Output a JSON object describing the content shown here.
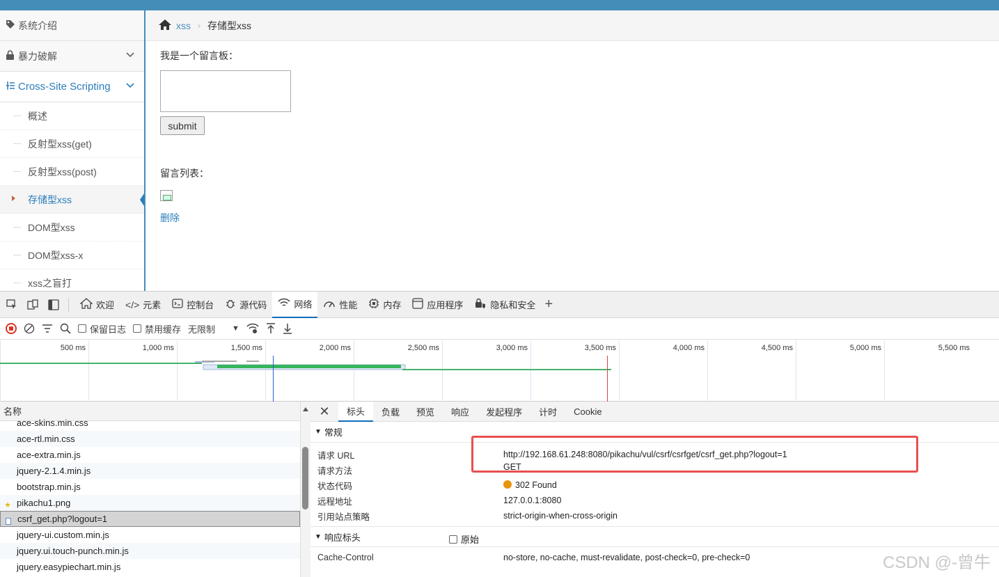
{
  "sidebar": {
    "items": [
      {
        "label": "系统介绍",
        "icon": "tag-icon"
      },
      {
        "label": "暴力破解",
        "icon": "lock-icon"
      },
      {
        "label": "Cross-Site Scripting",
        "icon": "list-icon"
      }
    ],
    "subitems": [
      "概述",
      "反射型xss(get)",
      "反射型xss(post)",
      "存储型xss",
      "DOM型xss",
      "DOM型xss-x",
      "xss之盲打"
    ]
  },
  "breadcrumb": {
    "link": "xss",
    "current": "存储型xss"
  },
  "main": {
    "board_label": "我是一个留言板：",
    "submit_label": "submit",
    "list_title": "留言列表：",
    "delete_label": "删除"
  },
  "devtools": {
    "tabs": [
      {
        "label": "欢迎",
        "icon": "home-icon"
      },
      {
        "label": "元素",
        "icon": "code-icon"
      },
      {
        "label": "控制台",
        "icon": "console-icon"
      },
      {
        "label": "源代码",
        "icon": "bug-icon"
      },
      {
        "label": "网络",
        "icon": "wifi-icon"
      },
      {
        "label": "性能",
        "icon": "gauge-icon"
      },
      {
        "label": "内存",
        "icon": "chip-icon"
      },
      {
        "label": "应用程序",
        "icon": "window-icon"
      },
      {
        "label": "隐私和安全",
        "icon": "shield-lock-icon"
      }
    ],
    "toolbar": {
      "preserve_log": "保留日志",
      "disable_cache": "禁用缓存",
      "throttle": "无限制"
    },
    "timeline_ticks": [
      "500 ms",
      "1,000 ms",
      "1,500 ms",
      "2,000 ms",
      "2,500 ms",
      "3,000 ms",
      "3,500 ms",
      "4,000 ms",
      "4,500 ms",
      "5,000 ms",
      "5,500 ms"
    ],
    "list_header": "名称",
    "requests": [
      "ace-skins.min.css",
      "ace-rtl.min.css",
      "ace-extra.min.js",
      "jquery-2.1.4.min.js",
      "bootstrap.min.js",
      "pikachu1.png",
      "csrf_get.php?logout=1",
      "jquery-ui.custom.min.js",
      "jquery.ui.touch-punch.min.js",
      "jquery.easypiechart.min.js"
    ],
    "detail_tabs": [
      "标头",
      "负载",
      "预览",
      "响应",
      "发起程序",
      "计时",
      "Cookie"
    ],
    "general_title": "常规",
    "general": [
      {
        "k": "请求 URL",
        "v": "http://192.168.61.248:8080/pikachu/vul/csrf/csrfget/csrf_get.php?logout=1"
      },
      {
        "k": "请求方法",
        "v": "GET"
      },
      {
        "k": "状态代码",
        "v": "302 Found"
      },
      {
        "k": "远程地址",
        "v": "127.0.0.1:8080"
      },
      {
        "k": "引用站点策略",
        "v": "strict-origin-when-cross-origin"
      }
    ],
    "response_title": "响应标头",
    "raw_label": "原始",
    "response": [
      {
        "k": "Cache-Control",
        "v": "no-store, no-cache, must-revalidate, post-check=0, pre-check=0"
      }
    ]
  },
  "watermark": "CSDN @-曾牛"
}
